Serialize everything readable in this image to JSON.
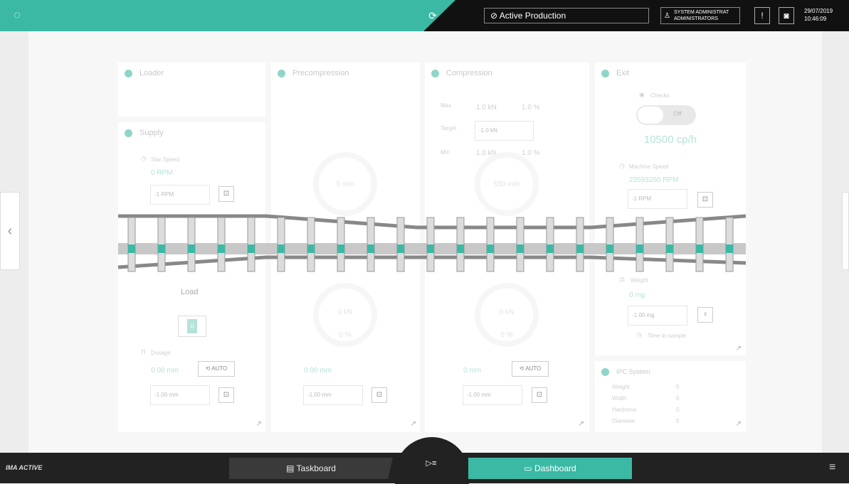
{
  "topbar": {
    "machine_state": "Active Production",
    "user_name": "SYSTEM ADMINISTRAT",
    "user_group": "ADMINISTRATORS",
    "date": "29/07/2019",
    "time": "10:46:09"
  },
  "panels": {
    "loader": {
      "title": "Loader"
    },
    "supply": {
      "title": "Supply",
      "star_speed_label": "Star Speed",
      "star_speed_value": "0 RPM",
      "star_speed_input": "-1 RPM",
      "load_label": "Load",
      "load_value": "0",
      "dosage_label": "Dosage",
      "dosage_value": "0.00 mm",
      "auto_label": "AUTO",
      "dosage_input": "-1.00 mm"
    },
    "precompression": {
      "title": "Precompression",
      "gauge_top": "0 mm",
      "gauge_bottom": "0 kN",
      "gauge_bottom_pct": "0 %",
      "value": "0.00 mm",
      "input": "-1.00 mm"
    },
    "compression": {
      "title": "Compression",
      "max_label": "Max",
      "max_kn": "1.0 kN",
      "max_pct": "1.0 %",
      "target_label": "Target",
      "target_input": "-1.0 kN",
      "min_label": "Min",
      "min_kn": "1.0 kN",
      "min_pct": "1.0 %",
      "gauge_top": "550 mm",
      "gauge_bottom": "0 kN",
      "gauge_bottom_pct": "0 %",
      "value": "0 mm",
      "auto_label": "AUTO",
      "input": "-1.00 mm"
    },
    "exit": {
      "title": "Exit",
      "checks_label": "Checks",
      "toggle_label": "Off",
      "production_rate": "10500 cp/h",
      "machine_speed_label": "Machine Speed",
      "machine_speed_value": "23593260 RPM",
      "machine_speed_input": "-1 RPM",
      "weight_label": "Weight",
      "weight_value": "0 mg",
      "weight_input": "-1.00 mg",
      "time_to_sample": "Time to sample"
    },
    "ipc": {
      "title": "IPC System",
      "rows": [
        {
          "label": "Weight",
          "value": "0"
        },
        {
          "label": "Width",
          "value": "0"
        },
        {
          "label": "Hardness",
          "value": "0"
        },
        {
          "label": "Diameter",
          "value": "0"
        }
      ]
    }
  },
  "bottombar": {
    "logo": "IMA ACTIVE",
    "taskboard_label": "Taskboard",
    "dashboard_label": "Dashboard"
  },
  "colors": {
    "accent": "#3bb9a5",
    "dark": "#111111"
  }
}
